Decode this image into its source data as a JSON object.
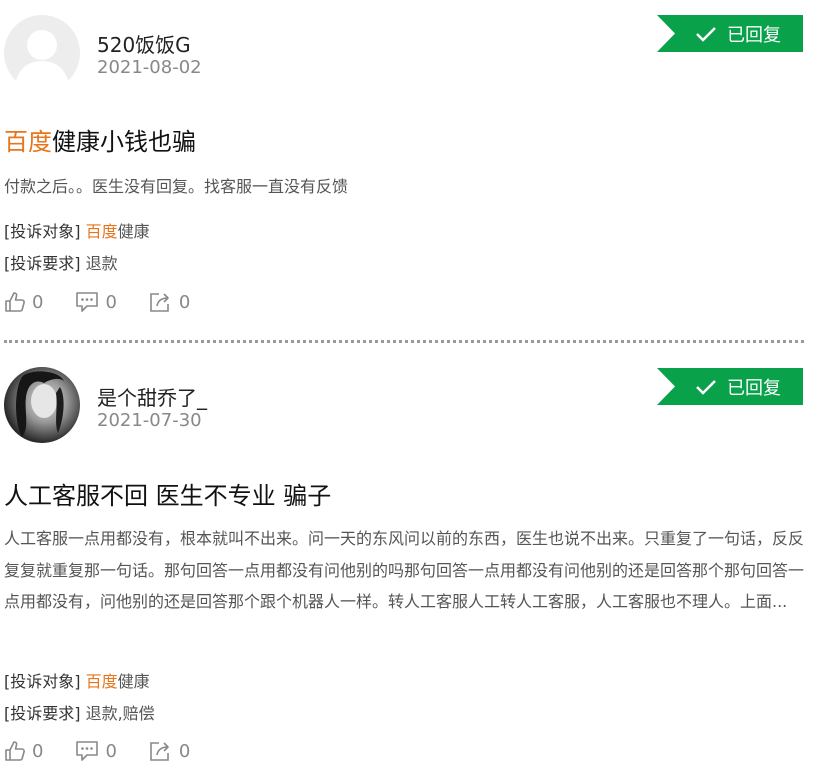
{
  "posts": [
    {
      "username": "520饭饭G",
      "date": "2021-08-02",
      "status": "已回复",
      "title_brand": "百度",
      "title_rest": "健康小钱也骗",
      "body": "付款之后。。医生没有回复。找客服一直没有反馈",
      "target_label": "[投诉对象]",
      "target_brand": "百度",
      "target_rest": "健康",
      "demand_label": "[投诉要求]",
      "demand_value": "退款",
      "likes": "0",
      "comments": "0",
      "shares": "0"
    },
    {
      "username": "是个甜乔了_",
      "date": "2021-07-30",
      "status": "已回复",
      "title_brand": "",
      "title_rest": "人工客服不回 医生不专业 骗子",
      "body": "人工客服一点用都没有，根本就叫不出来。问一天的东风问以前的东西，医生也说不出来。只重复了一句话，反反复复就重复那一句话。那句回答一点用都没有问他别的吗那句回答一点用都没有问他别的还是回答那个那句回答一点用都没有，问他别的还是回答那个跟个机器人一样。转人工客服人工转人工客服，人工客服也不理人。上面...",
      "target_label": "[投诉对象]",
      "target_brand": "百度",
      "target_rest": "健康",
      "demand_label": "[投诉要求]",
      "demand_value": "退款,赔偿",
      "likes": "0",
      "comments": "0",
      "shares": "0"
    }
  ],
  "icons": {
    "like": "thumbs-up-icon",
    "comment": "comment-icon",
    "share": "share-icon",
    "check": "check-icon"
  },
  "colors": {
    "brand": "#e8751a",
    "status_badge": "#0aa14b"
  }
}
